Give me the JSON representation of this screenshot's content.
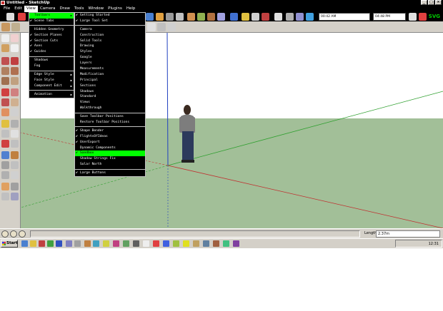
{
  "window": {
    "title": "Untitled - SketchUp"
  },
  "menubar": [
    {
      "label": "File"
    },
    {
      "label": "Edit"
    },
    {
      "label": "View",
      "active": true
    },
    {
      "label": "Camera"
    },
    {
      "label": "Draw"
    },
    {
      "label": "Tools"
    },
    {
      "label": "Window"
    },
    {
      "label": "Plugins"
    },
    {
      "label": "Help"
    }
  ],
  "toolbar_badges": {
    "stat1": "00:42 AM",
    "stat2": "04:48 PM",
    "svg_label": "SVG"
  },
  "view_menu": [
    {
      "label": "Toolbars",
      "checked": false,
      "submenu": true,
      "highlighted": true
    },
    {
      "label": "Scene Tabs",
      "checked": true,
      "submenu": false
    },
    {
      "type": "sep"
    },
    {
      "label": "Hidden Geometry",
      "checked": false
    },
    {
      "label": "Section Planes",
      "checked": true
    },
    {
      "label": "Section Cuts",
      "checked": true
    },
    {
      "label": "Axes",
      "checked": true
    },
    {
      "label": "Guides",
      "checked": true
    },
    {
      "type": "sep"
    },
    {
      "label": "Shadows",
      "checked": false
    },
    {
      "label": "Fog",
      "checked": false
    },
    {
      "type": "sep"
    },
    {
      "label": "Edge Style",
      "checked": false,
      "submenu": true
    },
    {
      "label": "Face Style",
      "checked": false,
      "submenu": true
    },
    {
      "label": "Component Edit",
      "checked": false,
      "submenu": true
    },
    {
      "type": "sep"
    },
    {
      "label": "Animation",
      "checked": false,
      "submenu": true
    }
  ],
  "toolbars_submenu": [
    {
      "label": "Getting Started",
      "checked": true
    },
    {
      "label": "Large Tool Set",
      "checked": true
    },
    {
      "type": "sep"
    },
    {
      "label": "Camera",
      "checked": false
    },
    {
      "label": "Construction",
      "checked": false
    },
    {
      "label": "Solid Tools",
      "checked": false
    },
    {
      "label": "Drawing",
      "checked": false
    },
    {
      "label": "Styles",
      "checked": false
    },
    {
      "label": "Google",
      "checked": false
    },
    {
      "label": "Layers",
      "checked": false
    },
    {
      "label": "Measurements",
      "checked": false
    },
    {
      "label": "Modification",
      "checked": false
    },
    {
      "label": "Principal",
      "checked": false
    },
    {
      "label": "Sections",
      "checked": false
    },
    {
      "label": "Shadows",
      "checked": false
    },
    {
      "label": "Standard",
      "checked": false
    },
    {
      "label": "Views",
      "checked": false
    },
    {
      "label": "Walkthrough",
      "checked": false
    },
    {
      "type": "sep"
    },
    {
      "label": "Save Toolbar Positions",
      "checked": false
    },
    {
      "label": "Restore Toolbar Positions",
      "checked": false
    },
    {
      "type": "sep"
    },
    {
      "label": "Shape Bender",
      "checked": true
    },
    {
      "label": "FlightsOfIdeas",
      "checked": true
    },
    {
      "label": "UserExport",
      "checked": true
    },
    {
      "label": "Dynamic Components",
      "checked": false
    },
    {
      "label": "Sandbox",
      "checked": true,
      "highlighted": true
    },
    {
      "label": "Shadow Strings Fix",
      "checked": false
    },
    {
      "label": "Solar North",
      "checked": false
    },
    {
      "type": "sep"
    },
    {
      "label": "Large Buttons",
      "checked": true
    }
  ],
  "statusbar": {
    "length_label": "Length",
    "length_value": "2.37m"
  },
  "taskbar": {
    "start_label": "Start",
    "clock": "12:31"
  },
  "colors": {
    "menu_bg": "#000000",
    "menu_text": "#ffffff",
    "menu_highlight": "#00ff00",
    "sky": "#ffffff",
    "ground": "#a2bf98",
    "axis_red": "#c03030",
    "axis_green": "#30a030",
    "axis_blue": "#2040c0"
  }
}
